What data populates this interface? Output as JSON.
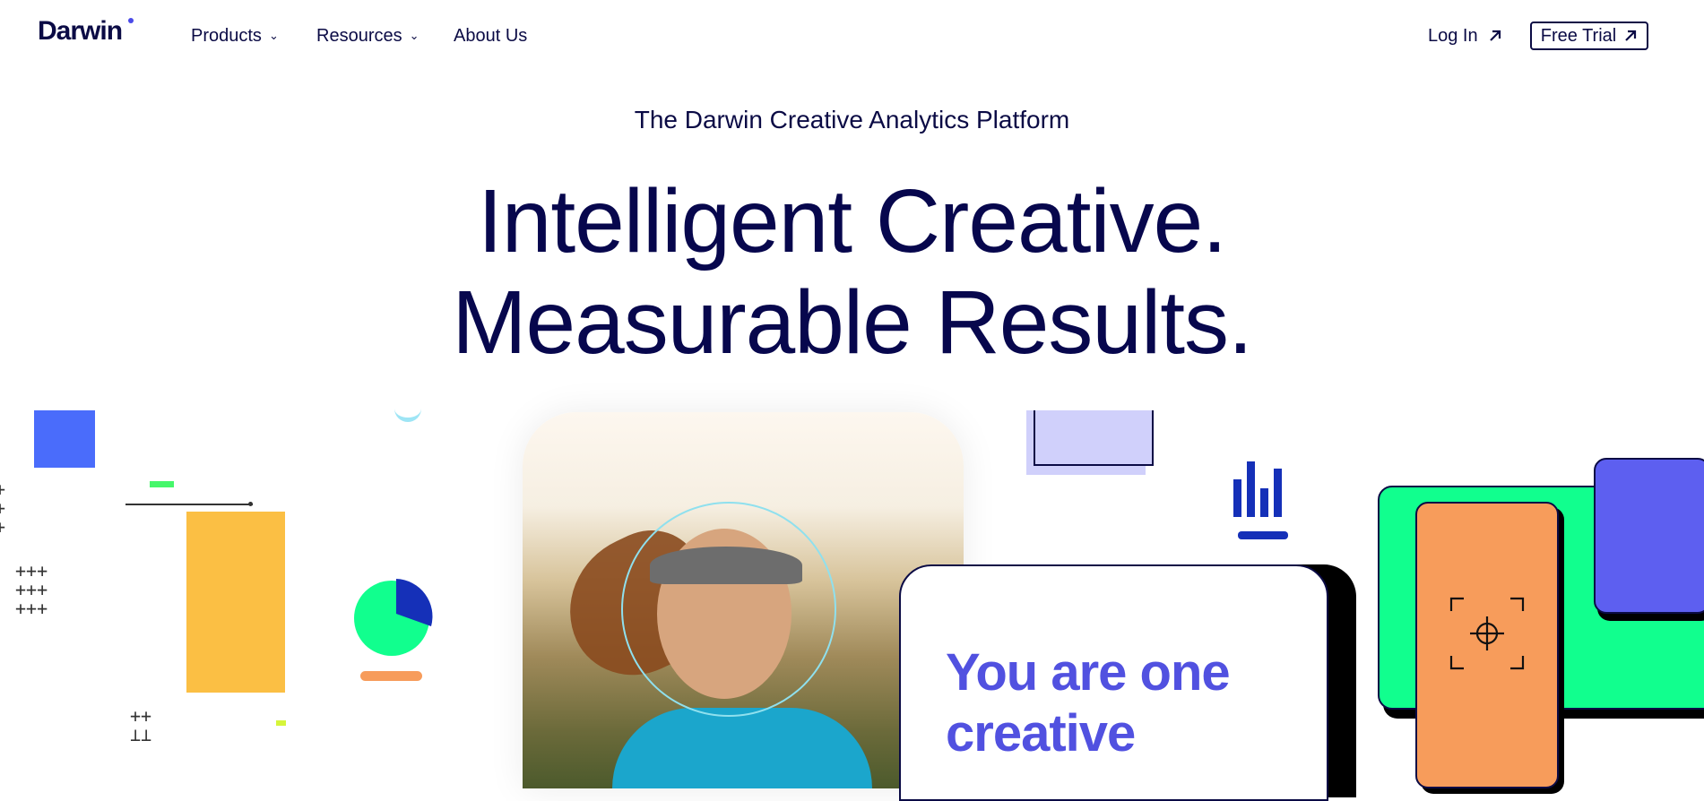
{
  "nav": {
    "logo": "Darwin",
    "items": [
      {
        "label": "Products",
        "has_dropdown": true
      },
      {
        "label": "Resources",
        "has_dropdown": true
      },
      {
        "label": "About Us",
        "has_dropdown": false
      }
    ],
    "login_label": "Log In",
    "trial_label": "Free Trial"
  },
  "hero": {
    "eyebrow": "The Darwin Creative Analytics Platform",
    "headline_line1": "Intelligent Creative.",
    "headline_line2": "Measurable Results."
  },
  "illustration": {
    "quote_line1": "You are one",
    "quote_line2": "creative"
  },
  "icons": {
    "dropdown": "chevron-down-icon",
    "external": "arrow-up-right-icon",
    "bar_chart": "bar-chart-icon",
    "pie_chart": "pie-chart-icon",
    "focus": "focus-crosshair-icon"
  },
  "colors": {
    "navy": "#0b0b45",
    "blue": "#4a6cfb",
    "yellow": "#fbbf44",
    "green": "#11ff8e",
    "orange": "#f79c5b",
    "indigo": "#5d5ff0",
    "lavender": "#d0d0fb",
    "royal": "#1530b8"
  }
}
